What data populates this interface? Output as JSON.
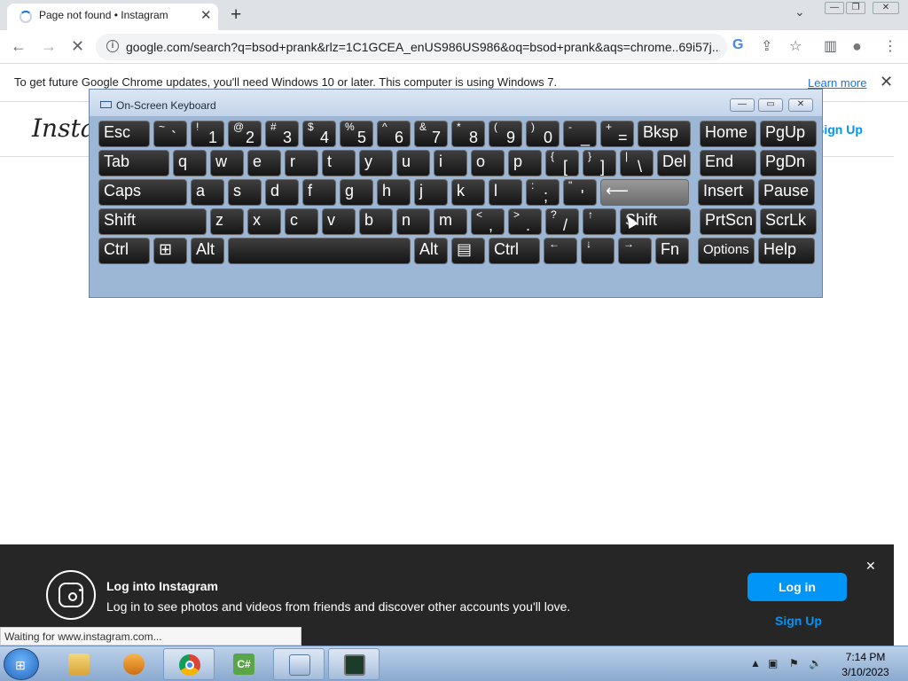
{
  "browser": {
    "tab_title": "Page not found • Instagram",
    "tab_close": "✕",
    "new_tab": "+",
    "tab_dropdown": "⌄",
    "window_controls": [
      "—",
      "❐",
      "✕"
    ],
    "back": "←",
    "forward": "→",
    "reload": "✕",
    "url": "google.com/search?q=bsod+prank&rlz=1C1GCEA_enUS986US986&oq=bsod+prank&aqs=chrome..69i57j...",
    "info_icon": "i",
    "google_icon": "G",
    "share_icon": "⇪",
    "star_icon": "☆",
    "sidepanel_icon": "▥",
    "profile_icon": "●",
    "menu_icon": "⋮"
  },
  "infobar": {
    "text": "To get future Google Chrome updates, you'll need Windows 10 or later. This computer is using Windows 7.",
    "learn_more": "Learn more",
    "close": "✕"
  },
  "page": {
    "logo_text": "Instagram",
    "signup_top": "Sign Up"
  },
  "osk": {
    "title": "On-Screen Keyboard",
    "controls": [
      "—",
      "▭",
      "✕"
    ],
    "rows": [
      [
        {
          "main": "Esc"
        },
        {
          "up": "~",
          "lo": "`"
        },
        {
          "up": "!",
          "lo": "1"
        },
        {
          "up": "@",
          "lo": "2"
        },
        {
          "up": "#",
          "lo": "3"
        },
        {
          "up": "$",
          "lo": "4"
        },
        {
          "up": "%",
          "lo": "5"
        },
        {
          "up": "^",
          "lo": "6"
        },
        {
          "up": "&",
          "lo": "7"
        },
        {
          "up": "*",
          "lo": "8"
        },
        {
          "up": "(",
          "lo": "9"
        },
        {
          "up": ")",
          "lo": "0"
        },
        {
          "up": "-",
          "lo": "_"
        },
        {
          "up": "+",
          "lo": "="
        },
        {
          "main": "Bksp"
        },
        {
          "main": "Home"
        },
        {
          "main": "PgUp"
        }
      ],
      [
        {
          "main": "Tab"
        },
        {
          "main": "q"
        },
        {
          "main": "w"
        },
        {
          "main": "e"
        },
        {
          "main": "r"
        },
        {
          "main": "t"
        },
        {
          "main": "y"
        },
        {
          "main": "u"
        },
        {
          "main": "i"
        },
        {
          "main": "o"
        },
        {
          "main": "p"
        },
        {
          "up": "{",
          "lo": "["
        },
        {
          "up": "}",
          "lo": "]"
        },
        {
          "up": "|",
          "lo": "\\"
        },
        {
          "main": "Del"
        },
        {
          "main": "End"
        },
        {
          "main": "PgDn"
        }
      ],
      [
        {
          "main": "Caps"
        },
        {
          "main": "a"
        },
        {
          "main": "s"
        },
        {
          "main": "d"
        },
        {
          "main": "f"
        },
        {
          "main": "g"
        },
        {
          "main": "h"
        },
        {
          "main": "j"
        },
        {
          "main": "k"
        },
        {
          "main": "l"
        },
        {
          "up": ":",
          "lo": ";"
        },
        {
          "up": "\"",
          "lo": "'"
        },
        {
          "main": "⟵"
        },
        {
          "main": "Insert"
        },
        {
          "main": "Pause"
        }
      ],
      [
        {
          "main": "Shift"
        },
        {
          "main": "z"
        },
        {
          "main": "x"
        },
        {
          "main": "c"
        },
        {
          "main": "v"
        },
        {
          "main": "b"
        },
        {
          "main": "n"
        },
        {
          "main": "m"
        },
        {
          "up": "<",
          "lo": ","
        },
        {
          "up": ">",
          "lo": "."
        },
        {
          "up": "?",
          "lo": "/"
        },
        {
          "up": "↑",
          "lo": ""
        },
        {
          "main": "Shift"
        },
        {
          "main": "PrtScn"
        },
        {
          "main": "ScrLk"
        }
      ],
      [
        {
          "main": "Ctrl"
        },
        {
          "main": "⊞"
        },
        {
          "main": "Alt"
        },
        {
          "main": ""
        },
        {
          "main": "Alt"
        },
        {
          "main": "▤"
        },
        {
          "main": "Ctrl"
        },
        {
          "up": "←",
          "lo": ""
        },
        {
          "up": "↓",
          "lo": ""
        },
        {
          "up": "→",
          "lo": ""
        },
        {
          "main": "Fn"
        },
        {
          "main": "Options"
        },
        {
          "main": "Help"
        }
      ]
    ]
  },
  "ig_banner": {
    "title": "Log into Instagram",
    "text": "Log in to see photos and videos from friends and discover other accounts you'll love.",
    "login_label": "Log in",
    "signup_label": "Sign Up",
    "close": "✕"
  },
  "status": {
    "text": "Waiting for www.instagram.com..."
  },
  "taskbar": {
    "time": "7:14 PM",
    "date": "3/10/2023",
    "apps": [
      "explorer-icon",
      "media-player-icon",
      "chrome-icon",
      "csharp-icon",
      "osk-icon",
      "monitor-icon"
    ],
    "tray_icons": [
      "▲",
      "▣",
      "⚑",
      "🔊"
    ]
  }
}
